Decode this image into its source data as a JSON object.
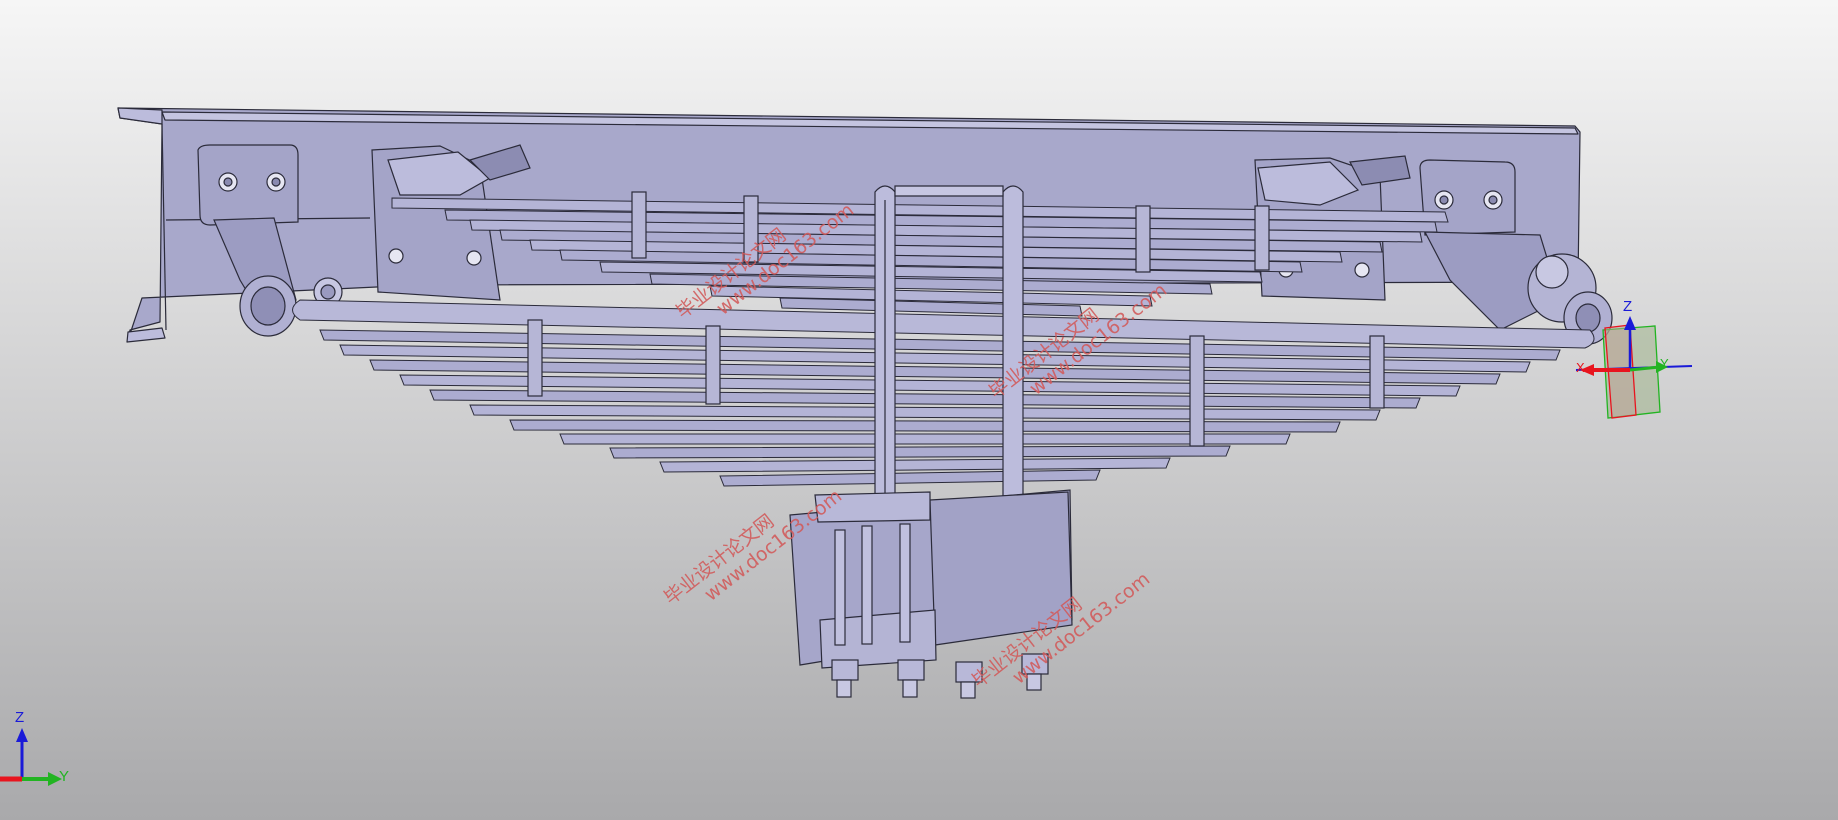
{
  "viewport": {
    "background_top": "#f6f6f6",
    "background_bottom": "#a9a9ab",
    "model_face_color": "#a9a9cc",
    "model_edge_color": "#2b2b3a"
  },
  "watermark": {
    "line1": "毕业设计论文网",
    "line2": "www.doc163.com",
    "color": "#d25a5a"
  },
  "triad_corner": {
    "z": "Z",
    "y": "Y"
  },
  "triad_model": {
    "z": "Z",
    "y": "Y",
    "x": "X"
  },
  "axis_colors": {
    "x": "#e8141e",
    "y": "#22b422",
    "z": "#1a1ad8"
  }
}
